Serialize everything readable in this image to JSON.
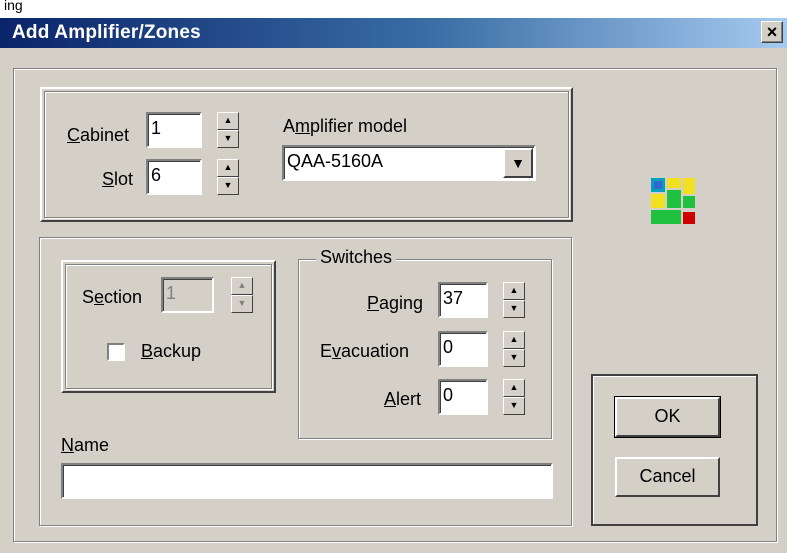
{
  "top_fragment": "ing",
  "window": {
    "title": "Add Amplifier/Zones",
    "close_glyph": "×"
  },
  "cabinet": {
    "label_u": "C",
    "label_rest": "abinet",
    "value": "1"
  },
  "slot": {
    "label_u": "S",
    "label_rest": "lot",
    "value": "6"
  },
  "amplifier_model": {
    "label_pre": "A",
    "label_u": "m",
    "label_rest": "plifier model",
    "selected": "QAA-5160A"
  },
  "section": {
    "label_pre": "S",
    "label_u": "e",
    "label_rest": "ction",
    "value": "1"
  },
  "backup": {
    "label_u": "B",
    "label_rest": "ackup",
    "checked": false
  },
  "switches": {
    "title": "Switches",
    "paging": {
      "label_u": "P",
      "label_rest": "aging",
      "value": "37"
    },
    "evacuation": {
      "label_pre": "E",
      "label_u": "v",
      "label_rest": "acuation",
      "value": "0"
    },
    "alert": {
      "label_u": "A",
      "label_rest": "lert",
      "value": "0"
    }
  },
  "name": {
    "label_u": "N",
    "label_rest": "ame",
    "value": ""
  },
  "buttons": {
    "ok": "OK",
    "cancel": "Cancel"
  },
  "icons": {
    "app_icon": "zones-app-icon",
    "up": "▲",
    "down": "▼"
  }
}
